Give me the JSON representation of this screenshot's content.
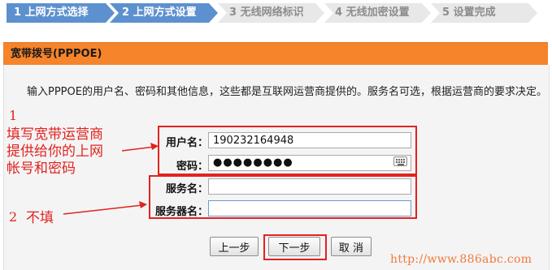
{
  "wizard": {
    "steps": [
      {
        "label": "1 上网方式选择",
        "state": "active"
      },
      {
        "label": "2 上网方式设置",
        "state": "active"
      },
      {
        "label": "3 无线网络标识",
        "state": "inactive"
      },
      {
        "label": "4 无线加密设置",
        "state": "inactive"
      },
      {
        "label": "5 设置完成",
        "state": "inactive"
      }
    ]
  },
  "panel": {
    "title": "宽带拨号(PPPOE)",
    "description": "输入PPPOE的用户名、密码和其他信息，这些都是互联网运营商提供的。服务名可选，根据运营商的要求决定。"
  },
  "form": {
    "username_label": "用户名：",
    "username_value": "190232164948",
    "password_label": "密码：",
    "password_value": "●●●●●●●●",
    "service_label": "服务名：",
    "service_value": "",
    "server_label": "服务器名：",
    "server_value": ""
  },
  "annotations": {
    "num1": "1",
    "note1_line1": "填写宽带运营商",
    "note1_line2": "提供给你的上网",
    "note1_line3": "帐号和密码",
    "num2": "2",
    "note2": "不填"
  },
  "buttons": {
    "prev": "上一步",
    "next": "下一步",
    "cancel": "取 消"
  },
  "watermark": "http://www.886abc.com",
  "colors": {
    "active_step": "#5d90cf",
    "header_orange": "#f6842a",
    "annotation_red": "#e1231f"
  },
  "icons": {
    "keyboard": "keyboard-icon"
  }
}
